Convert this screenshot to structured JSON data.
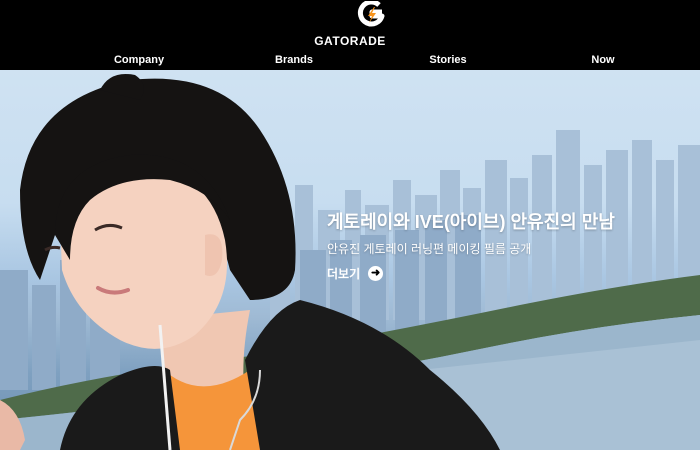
{
  "brand": {
    "name": "GATORADE",
    "logo_icon": "gatorade-g-bolt-icon",
    "accent": "#F7941D"
  },
  "nav": {
    "items": [
      {
        "label": "Company"
      },
      {
        "label": "Brands"
      },
      {
        "label": "Stories"
      },
      {
        "label": "Now"
      }
    ]
  },
  "hero": {
    "headline": "게토레이와 IVE(아이브) 안유진의 만남",
    "subline": "안유진 게토레이 러닝편 메이킹 필름 공개",
    "more_label": "더보기",
    "more_icon": "arrow-right-circle-icon"
  }
}
